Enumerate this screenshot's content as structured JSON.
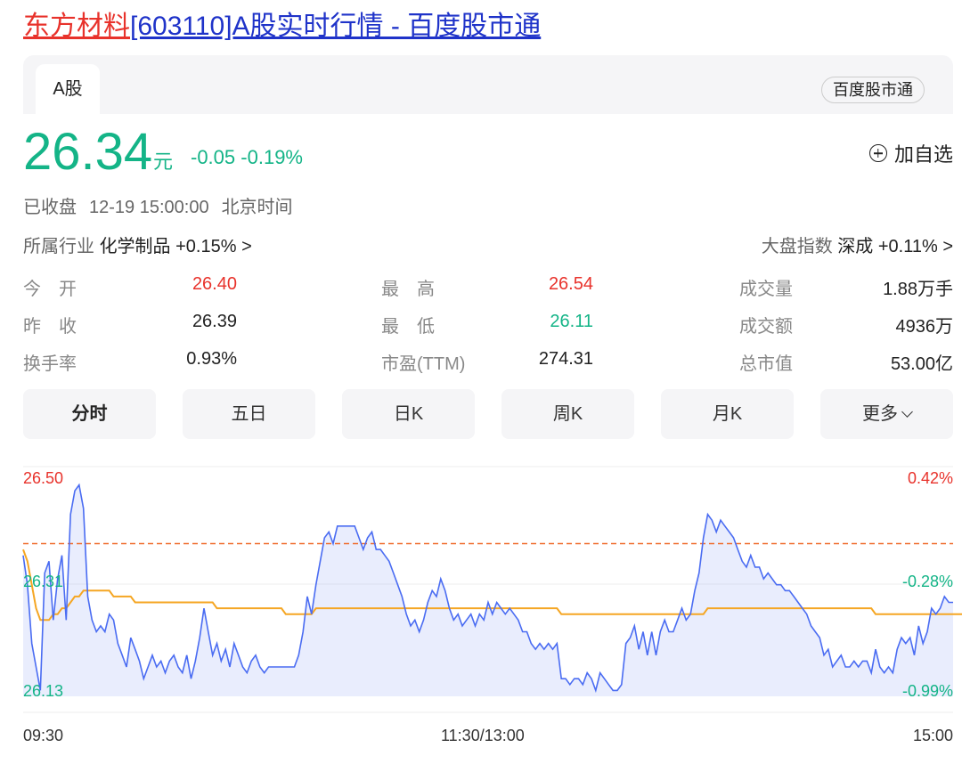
{
  "title": {
    "name": "东方材料",
    "rest": "[603110]A股实时行情 - 百度股市通"
  },
  "tabs": {
    "active": "A股",
    "brand": "百度股市通"
  },
  "quote": {
    "price": "26.34",
    "unit": "元",
    "change": "-0.05",
    "change_pct": "-0.19%",
    "watch_label": "加自选"
  },
  "status": {
    "state": "已收盘",
    "time": "12-19 15:00:00",
    "zone": "北京时间"
  },
  "industry": {
    "label": "所属行业",
    "name": "化学制品",
    "change": "+0.15%",
    "arrow": ">"
  },
  "index": {
    "label": "大盘指数",
    "name": "深成",
    "change": "+0.11%",
    "arrow": ">"
  },
  "stats": [
    [
      {
        "label": "今　开",
        "value": "26.40"
      },
      {
        "label": "最　高",
        "value": "26.54"
      },
      {
        "label": "成交量",
        "value": "1.88万手"
      }
    ],
    [
      {
        "label": "昨　收",
        "value": "26.39"
      },
      {
        "label": "最　低",
        "value": "26.11"
      },
      {
        "label": "成交额",
        "value": "4936万"
      }
    ],
    [
      {
        "label": "换手率",
        "value": "0.93%"
      },
      {
        "label": "市盈(TTM)",
        "value": "274.31"
      },
      {
        "label": "总市值",
        "value": "53.00亿"
      }
    ]
  ],
  "periods": [
    "分时",
    "五日",
    "日K",
    "周K",
    "月K",
    "更多"
  ],
  "colors": {
    "up": "#e8322b",
    "down": "#14b487",
    "price_line": "#4a6cf2",
    "avg_line": "#f5a623",
    "ref_line": "#f06a2a"
  },
  "chart_data": {
    "type": "line",
    "y_left_ticks": [
      "26.50",
      "26.31",
      "26.13"
    ],
    "y_right_ticks": [
      "0.42%",
      "-0.28%",
      "-0.99%"
    ],
    "x_ticks": [
      "09:30",
      "11:30/13:00",
      "15:00"
    ],
    "ylim": [
      26.13,
      26.5
    ],
    "prev_close": 26.39,
    "price": [
      26.37,
      26.32,
      26.22,
      26.18,
      26.14,
      26.34,
      26.36,
      26.26,
      26.33,
      26.37,
      26.26,
      26.44,
      26.48,
      26.49,
      26.45,
      26.3,
      26.26,
      26.24,
      26.25,
      26.24,
      26.27,
      26.26,
      26.22,
      26.2,
      26.18,
      26.23,
      26.21,
      26.19,
      26.16,
      26.18,
      26.2,
      26.18,
      26.19,
      26.17,
      26.19,
      26.2,
      26.18,
      26.17,
      26.2,
      26.16,
      26.19,
      26.23,
      26.28,
      26.24,
      26.2,
      26.22,
      26.19,
      26.21,
      26.18,
      26.22,
      26.2,
      26.18,
      26.17,
      26.19,
      26.2,
      26.18,
      26.17,
      26.18,
      26.18,
      26.18,
      26.18,
      26.18,
      26.18,
      26.18,
      26.2,
      26.24,
      26.3,
      26.27,
      26.32,
      26.36,
      26.4,
      26.41,
      26.39,
      26.42,
      26.42,
      26.42,
      26.42,
      26.42,
      26.4,
      26.38,
      26.4,
      26.41,
      26.38,
      26.38,
      26.37,
      26.36,
      26.34,
      26.32,
      26.3,
      26.27,
      26.25,
      26.26,
      26.24,
      26.26,
      26.29,
      26.31,
      26.3,
      26.33,
      26.31,
      26.28,
      26.26,
      26.27,
      26.25,
      26.26,
      26.27,
      26.25,
      26.27,
      26.26,
      26.29,
      26.27,
      26.29,
      26.28,
      26.27,
      26.28,
      26.27,
      26.26,
      26.24,
      26.24,
      26.22,
      26.21,
      26.22,
      26.21,
      26.22,
      26.21,
      26.22,
      26.16,
      26.16,
      26.15,
      26.16,
      26.16,
      26.15,
      26.17,
      26.16,
      26.14,
      26.17,
      26.16,
      26.15,
      26.14,
      26.14,
      26.15,
      26.22,
      26.23,
      26.25,
      26.21,
      26.24,
      26.2,
      26.24,
      26.2,
      26.24,
      26.26,
      26.24,
      26.24,
      26.26,
      26.28,
      26.26,
      26.27,
      26.31,
      26.34,
      26.4,
      26.44,
      26.43,
      26.41,
      26.43,
      26.42,
      26.41,
      26.4,
      26.38,
      26.36,
      26.35,
      26.37,
      26.35,
      26.35,
      26.33,
      26.34,
      26.33,
      26.32,
      26.32,
      26.31,
      26.31,
      26.3,
      26.29,
      26.28,
      26.27,
      26.25,
      26.24,
      26.23,
      26.2,
      26.21,
      26.18,
      26.19,
      26.2,
      26.18,
      26.18,
      26.19,
      26.18,
      26.19,
      26.19,
      26.17,
      26.21,
      26.18,
      26.17,
      26.18,
      26.17,
      26.21,
      26.23,
      26.22,
      26.23,
      26.2,
      26.25,
      26.22,
      26.24,
      26.28,
      26.27,
      26.28,
      26.3,
      26.29,
      26.29
    ],
    "avg": [
      26.38,
      26.36,
      26.32,
      26.28,
      26.26,
      26.26,
      26.26,
      26.27,
      26.27,
      26.28,
      26.28,
      26.29,
      26.3,
      26.3,
      26.31,
      26.31,
      26.31,
      26.31,
      26.31,
      26.31,
      26.31,
      26.3,
      26.3,
      26.3,
      26.3,
      26.3,
      26.29,
      26.29,
      26.29,
      26.29,
      26.29,
      26.29,
      26.29,
      26.29,
      26.29,
      26.29,
      26.29,
      26.29,
      26.29,
      26.29,
      26.29,
      26.29,
      26.29,
      26.29,
      26.29,
      26.28,
      26.28,
      26.28,
      26.28,
      26.28,
      26.28,
      26.28,
      26.28,
      26.28,
      26.28,
      26.28,
      26.28,
      26.28,
      26.28,
      26.28,
      26.28,
      26.27,
      26.27,
      26.27,
      26.27,
      26.27,
      26.27,
      26.27,
      26.28,
      26.28,
      26.28,
      26.28,
      26.28,
      26.28,
      26.28,
      26.28,
      26.28,
      26.28,
      26.28,
      26.28,
      26.28,
      26.28,
      26.28,
      26.28,
      26.28,
      26.28,
      26.28,
      26.28,
      26.28,
      26.28,
      26.28,
      26.28,
      26.28,
      26.28,
      26.28,
      26.28,
      26.28,
      26.28,
      26.28,
      26.28,
      26.28,
      26.28,
      26.28,
      26.28,
      26.28,
      26.28,
      26.28,
      26.28,
      26.28,
      26.28,
      26.28,
      26.28,
      26.28,
      26.28,
      26.28,
      26.28,
      26.28,
      26.28,
      26.28,
      26.28,
      26.28,
      26.28,
      26.28,
      26.28,
      26.28,
      26.27,
      26.27,
      26.27,
      26.27,
      26.27,
      26.27,
      26.27,
      26.27,
      26.27,
      26.27,
      26.27,
      26.27,
      26.27,
      26.27,
      26.27,
      26.27,
      26.27,
      26.27,
      26.27,
      26.27,
      26.27,
      26.27,
      26.27,
      26.27,
      26.27,
      26.27,
      26.27,
      26.27,
      26.27,
      26.27,
      26.27,
      26.27,
      26.27,
      26.27,
      26.28,
      26.28,
      26.28,
      26.28,
      26.28,
      26.28,
      26.28,
      26.28,
      26.28,
      26.28,
      26.28,
      26.28,
      26.28,
      26.28,
      26.28,
      26.28,
      26.28,
      26.28,
      26.28,
      26.28,
      26.28,
      26.28,
      26.28,
      26.28,
      26.28,
      26.28,
      26.28,
      26.28,
      26.28,
      26.28,
      26.28,
      26.28,
      26.28,
      26.28,
      26.28,
      26.28,
      26.28,
      26.28,
      26.28,
      26.27,
      26.27,
      26.27,
      26.27,
      26.27,
      26.27,
      26.27,
      26.27,
      26.27,
      26.27,
      26.27,
      26.27,
      26.27,
      26.27,
      26.27,
      26.27,
      26.27,
      26.27,
      26.27,
      26.27,
      26.27,
      26.27
    ]
  }
}
